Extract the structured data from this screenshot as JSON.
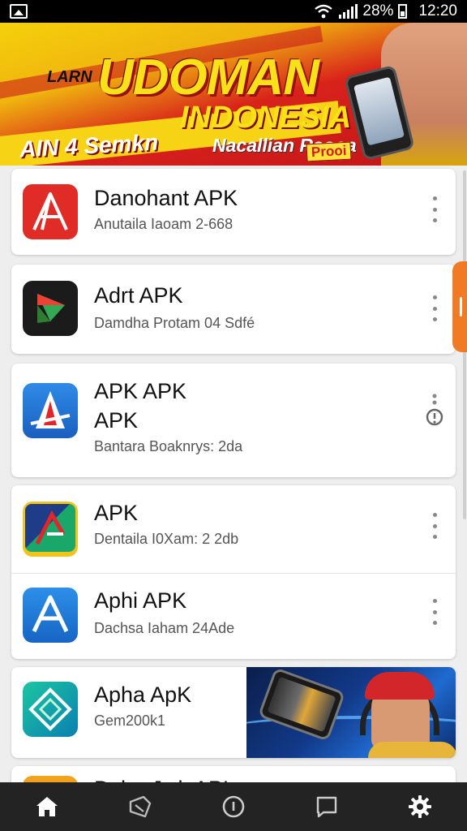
{
  "status_bar": {
    "battery": "28%",
    "time": "12:20",
    "icons": [
      "image-notification-icon",
      "wifi-icon",
      "signal-icon",
      "battery-icon"
    ]
  },
  "banner": {
    "line1": "LARN",
    "line2": "UDOMAN",
    "line3": "INDONESIA",
    "line4": "AIN 4 Semkn",
    "line5": "Nacallian Raooa",
    "line6": "Prooi"
  },
  "apps": [
    {
      "title": "Danohant APK",
      "subtitle": "Anutaila Iaoam 2-668"
    },
    {
      "title": "Adrt APK",
      "subtitle": "Damdha Protam 04 Sdfé"
    },
    {
      "title": "APK APK APK",
      "subtitle": "Bantara Boaknrys: 2da"
    },
    {
      "title": "APK",
      "subtitle": "Dentaila I0Xam: 2 2db"
    },
    {
      "title": "Aphi APK",
      "subtitle": "Dachsa Iaham 24Ade"
    },
    {
      "title": "Apha ApK",
      "subtitle": "Gem200k1"
    },
    {
      "title": "Dcha Jwk APL",
      "subtitle": ""
    }
  ],
  "colors": {
    "accent_orange": "#f07b24",
    "banner_red": "#d8231b",
    "banner_yellow": "#f4d10b",
    "nav_bg": "#232323"
  },
  "bottom_nav": [
    {
      "name": "home",
      "icon": "home-icon"
    },
    {
      "name": "tag",
      "icon": "tag-icon"
    },
    {
      "name": "compass",
      "icon": "compass-icon"
    },
    {
      "name": "messages",
      "icon": "message-square-icon"
    },
    {
      "name": "settings",
      "icon": "gear-icon"
    }
  ]
}
